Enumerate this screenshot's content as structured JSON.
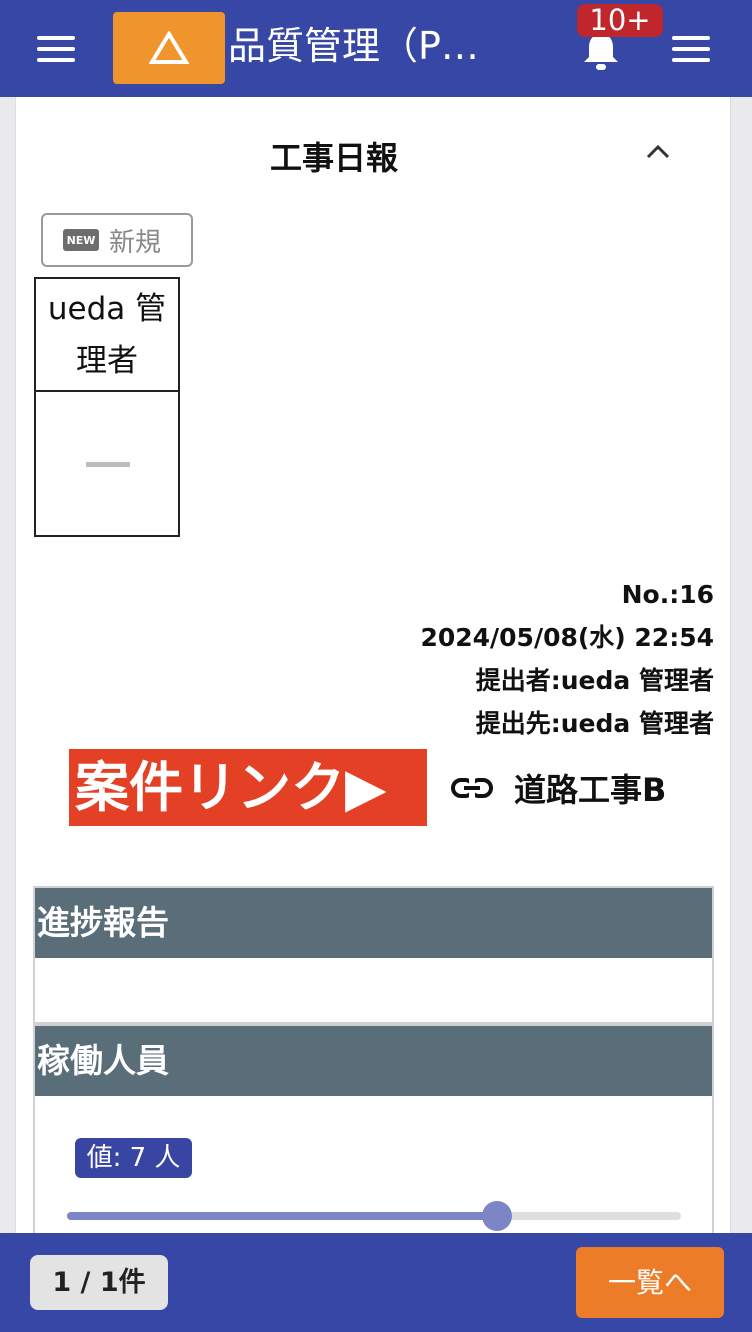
{
  "header": {
    "title": "品質管理（P…",
    "notification_count": "10+",
    "left_menu_icon": "hamburger-menu-icon",
    "warning_icon": "warning-triangle-icon",
    "bell_icon": "bell-icon",
    "right_menu_icon": "hamburger-menu-icon",
    "color": "#3747a6",
    "warning_color": "#f0952e"
  },
  "report": {
    "title": "工事日報",
    "new_badge": "NEW",
    "new_label": "新規",
    "approver_name": "ueda 管理者",
    "number": "No.:16",
    "datetime": "2024/05/08(水) 22:54",
    "submitter": "提出者:ueda 管理者",
    "recipient": "提出先:ueda 管理者",
    "case_link_label": "案件リンク▶",
    "case_name": "道路工事B"
  },
  "sections": {
    "progress_title": "進捗報告",
    "workers_title": "稼働人員",
    "workers_value_label": "値: 7 人"
  },
  "slider": {
    "fraction": 0.7
  },
  "footer": {
    "pager": "1 / 1件",
    "list_button": "一覧へ"
  }
}
